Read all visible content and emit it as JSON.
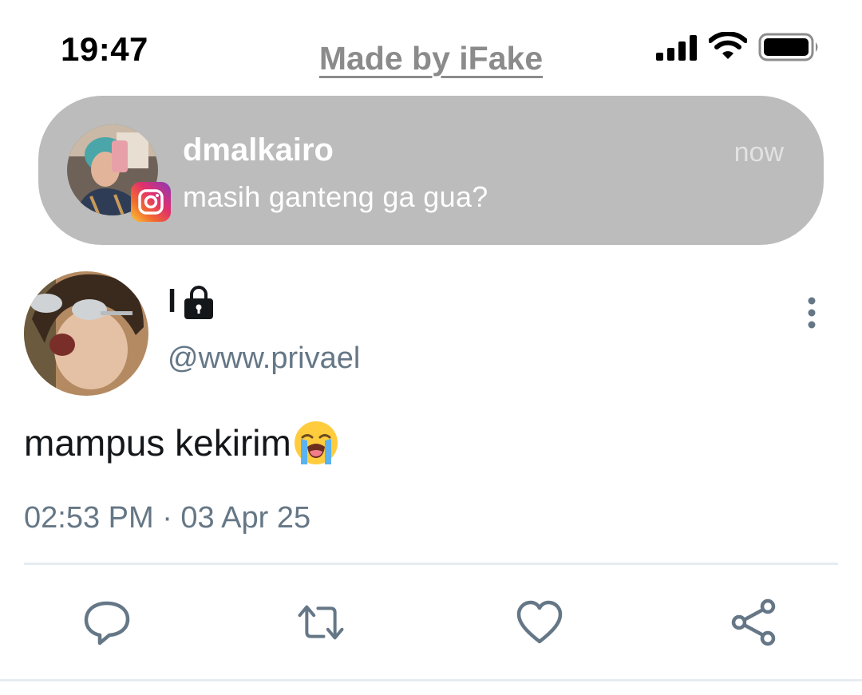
{
  "status_bar": {
    "time": "19:47",
    "watermark": "Made by iFake"
  },
  "notification": {
    "app_icon": "instagram-icon",
    "username": "dmalkairo",
    "time": "now",
    "message": "masih ganteng ga gua?"
  },
  "tweet": {
    "display_name": "l",
    "handle": "@www.privael",
    "text": "mampus kekirim",
    "emoji": "loudly-crying-face",
    "timestamp": "02:53 PM · 03 Apr 25"
  },
  "actions": [
    "reply-icon",
    "retweet-icon",
    "like-icon",
    "share-icon"
  ],
  "colors": {
    "banner": "#bcbcbc",
    "secondary_text": "#657786",
    "icon_gray": "#657786",
    "divider": "#e6ecf0"
  }
}
